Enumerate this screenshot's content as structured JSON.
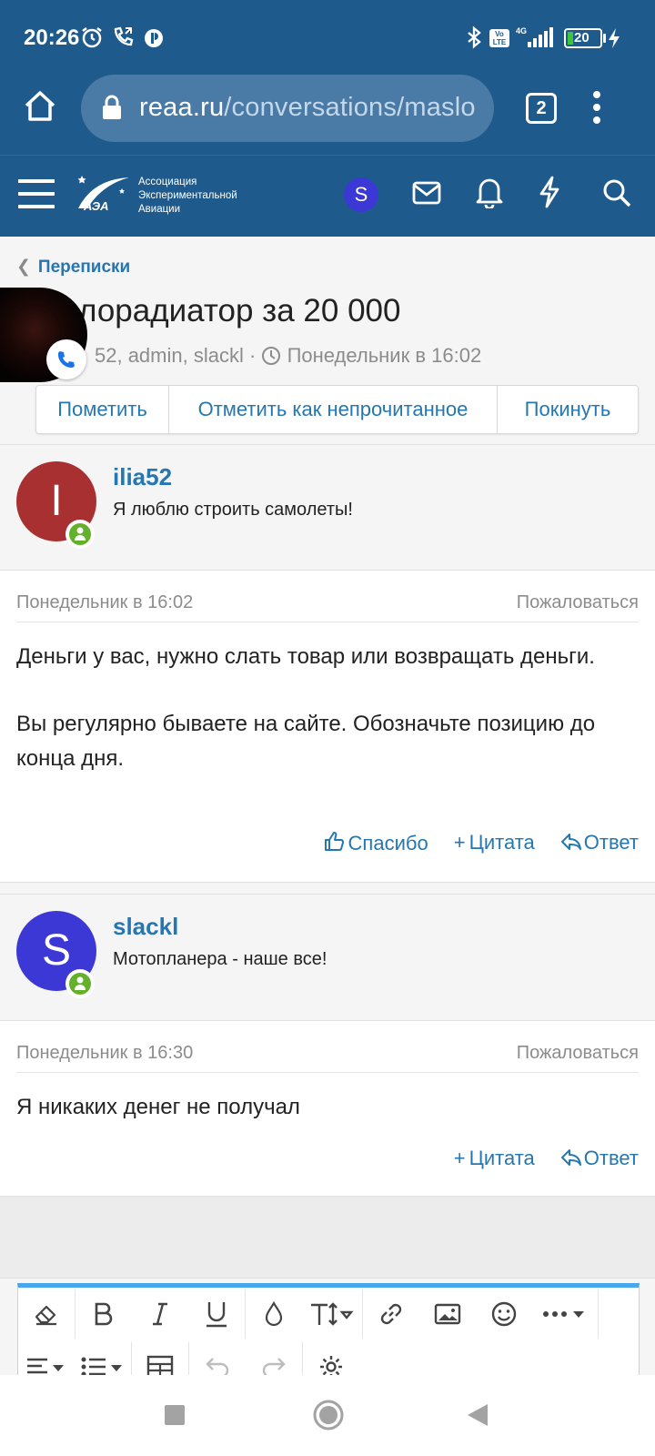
{
  "status_bar": {
    "time": "20:26",
    "battery": "20",
    "network": "4G"
  },
  "browser": {
    "url_domain": "reaa.ru",
    "url_path": "/conversations/maslo",
    "tab_count": "2"
  },
  "site_header": {
    "logo_abbr": "АЭА",
    "logo_line1": "Ассоциация",
    "logo_line2": "Экспериментальной",
    "logo_line3": "Авиации",
    "user_initial": "S"
  },
  "conversation": {
    "breadcrumb": "Переписки",
    "title": "лорадиатор за 20 000",
    "participants": "52, admin, slackl",
    "meta_date": "Понедельник в 16:02",
    "actions": [
      "Пометить",
      "Отметить как непрочитанное",
      "Покинуть"
    ]
  },
  "messages": [
    {
      "username": "ilia52",
      "user_title": "Я люблю строить самолеты!",
      "avatar_letter": "I",
      "avatar_color": "#a83030",
      "date": "Понедельник в 16:02",
      "report": "Пожаловаться",
      "body_p1": "Деньги у вас, нужно слать товар или возвращать деньги.",
      "body_p2": "Вы регулярно бываете на сайте. Обозначьте позицию до конца дня.",
      "like": "Спасибо",
      "quote": "Цитата",
      "reply": "Ответ"
    },
    {
      "username": "slackl",
      "user_title": "Мотопланера - наше все!",
      "avatar_letter": "S",
      "avatar_color": "#3c38d6",
      "date": "Понедельник в 16:30",
      "report": "Пожаловаться",
      "body_p1": "Я никаких денег не получал",
      "quote": "Цитата",
      "reply": "Ответ"
    }
  ],
  "colors": {
    "header_bg": "#1e5a8b",
    "link": "#2577b1",
    "online": "#63b02a",
    "editor_accent": "#47a7eb"
  }
}
